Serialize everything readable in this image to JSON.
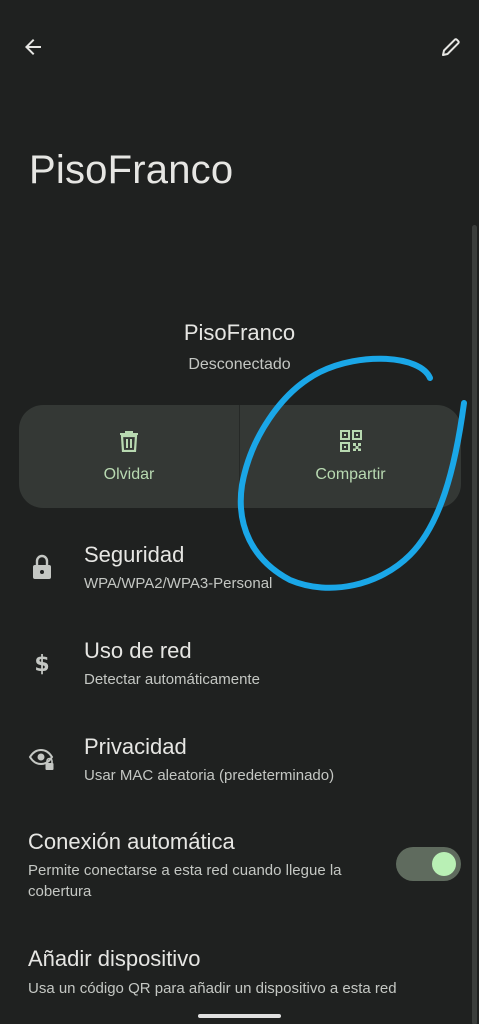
{
  "title": "PisoFranco",
  "header": {
    "network_name": "PisoFranco",
    "status": "Desconectado"
  },
  "actions": {
    "forget_label": "Olvidar",
    "share_label": "Compartir"
  },
  "rows": {
    "security": {
      "title": "Seguridad",
      "subtitle": "WPA/WPA2/WPA3-Personal",
      "icon": "lock-icon"
    },
    "network_usage": {
      "title": "Uso de red",
      "subtitle": "Detectar automáticamente",
      "icon": "dollar-icon"
    },
    "privacy": {
      "title": "Privacidad",
      "subtitle": "Usar MAC aleatoria (predeterminado)",
      "icon": "eye-lock-icon"
    }
  },
  "auto_connect": {
    "title": "Conexión automática",
    "subtitle": "Permite conectarse a esta red cuando llegue la cobertura",
    "enabled": true
  },
  "add_device": {
    "title": "Añadir dispositivo",
    "subtitle": "Usa un código QR para añadir un dispositivo a esta red"
  },
  "colors": {
    "background": "#1f2120",
    "accent_text": "#b8d9b1",
    "toggle_track": "#5f6b5e",
    "toggle_knob": "#b9f0b5",
    "annotation": "#1aa7e8"
  }
}
